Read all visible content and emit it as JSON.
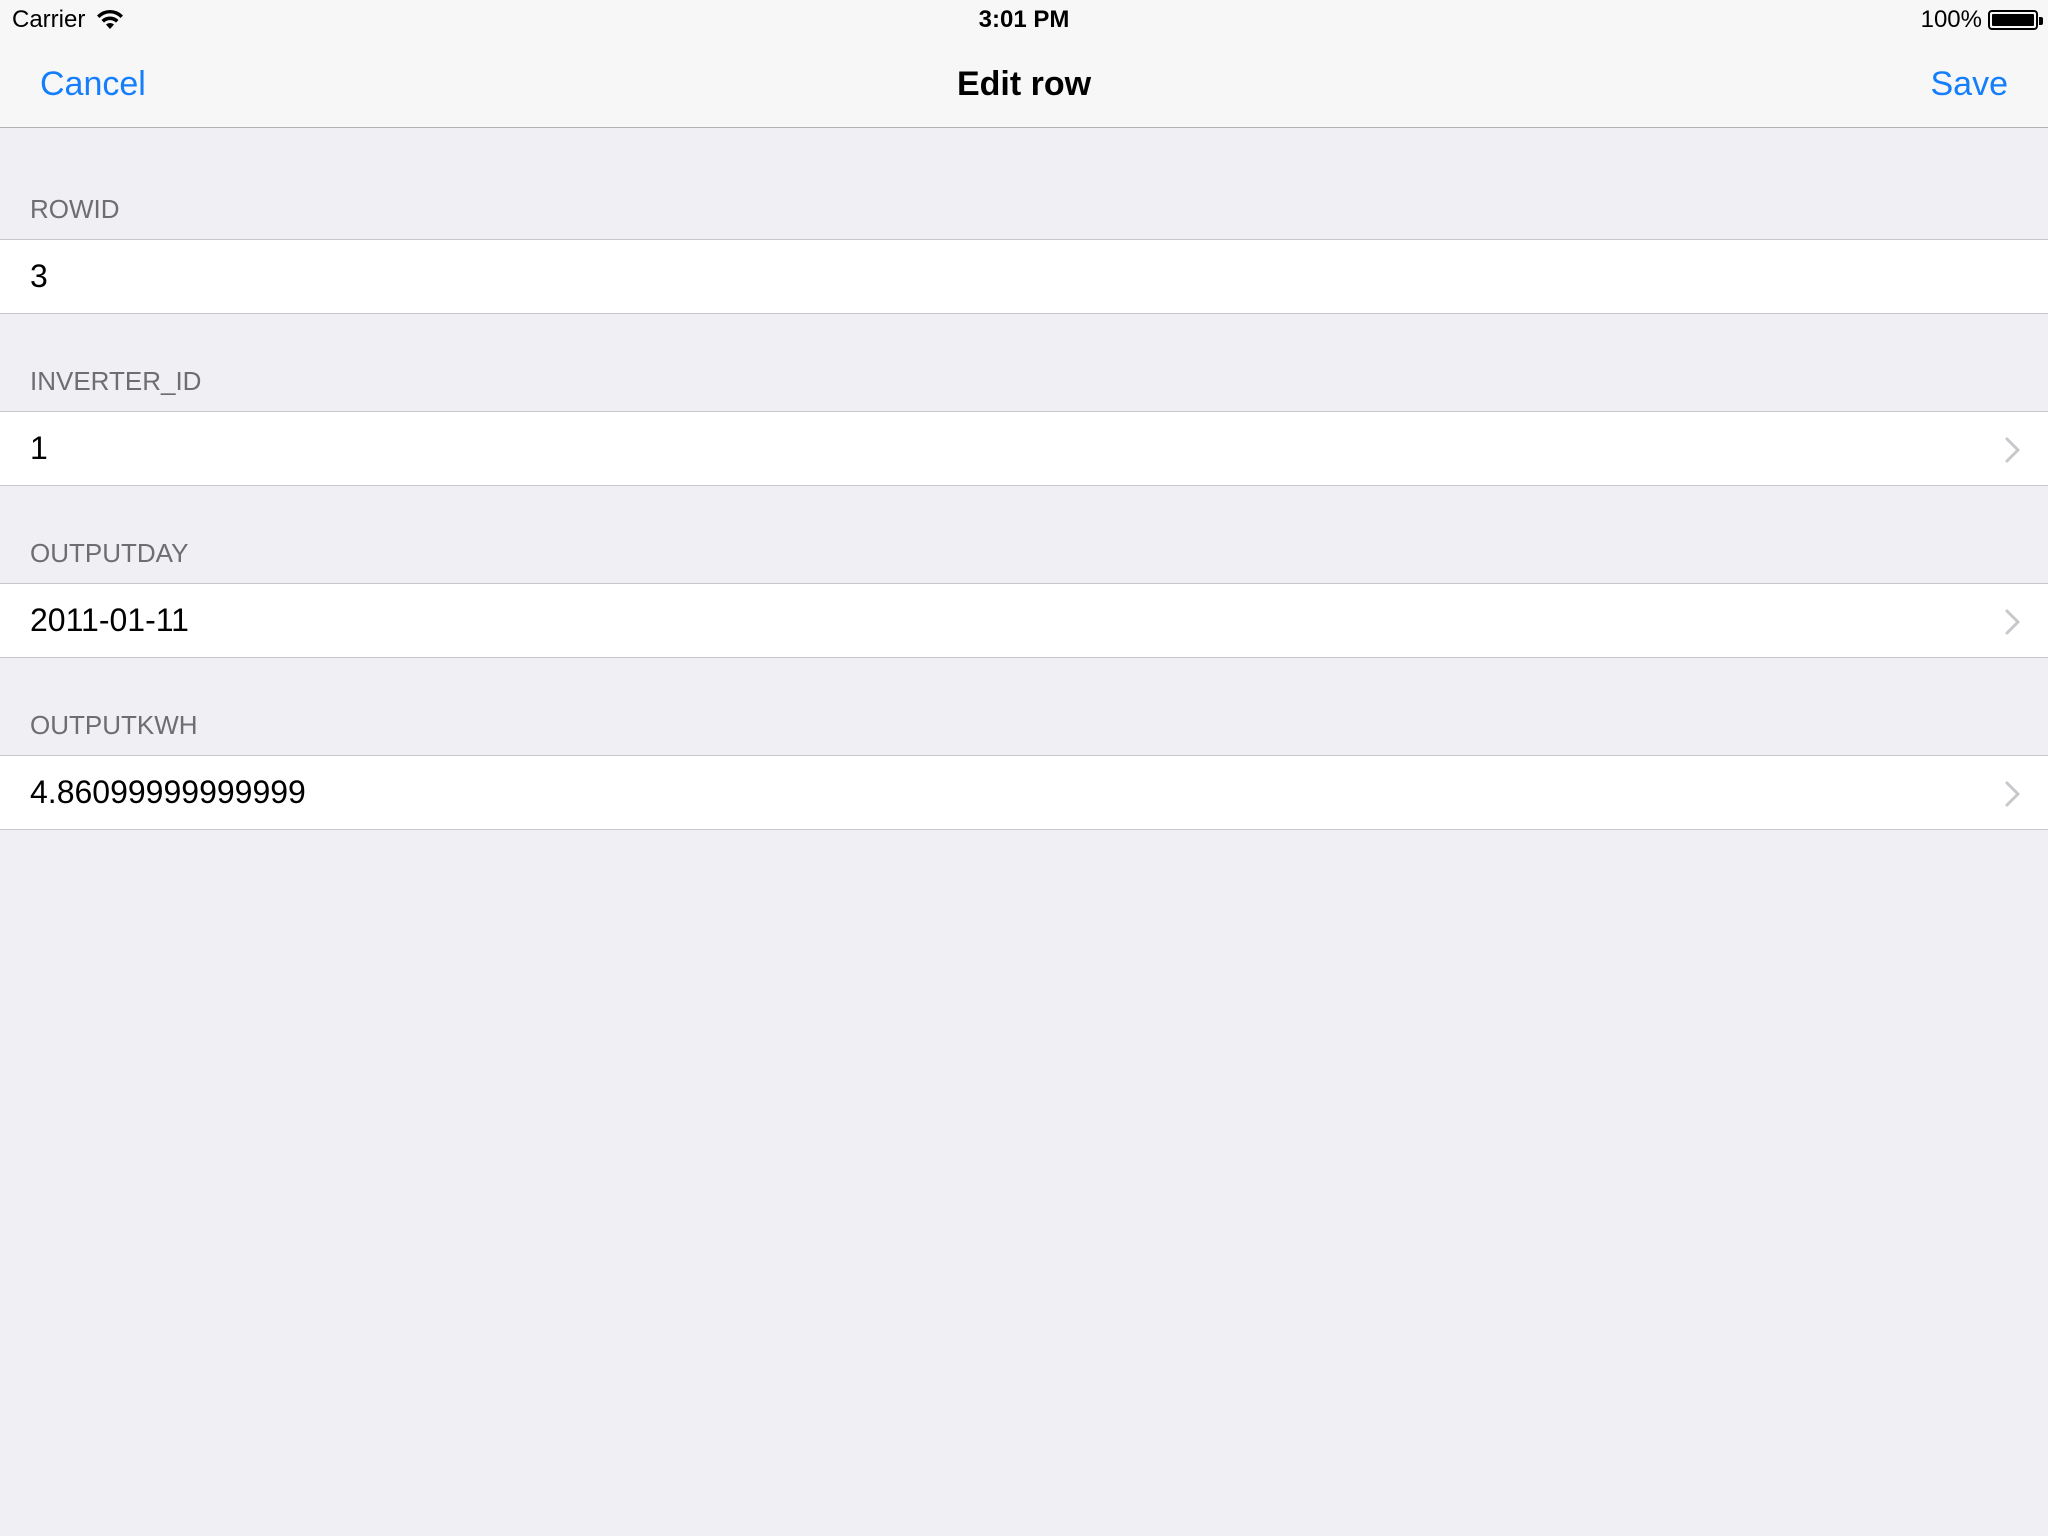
{
  "status_bar": {
    "carrier": "Carrier",
    "time": "3:01 PM",
    "battery": "100%",
    "battery_level": 1.0,
    "wifi_icon": "wifi-icon",
    "battery_icon": "battery-icon"
  },
  "nav": {
    "cancel_label": "Cancel",
    "title": "Edit row",
    "save_label": "Save",
    "accent_color": "#147efb"
  },
  "fields": [
    {
      "label": "ROWID",
      "value": "3",
      "has_chevron": false
    },
    {
      "label": "INVERTER_ID",
      "value": "1",
      "has_chevron": true
    },
    {
      "label": "OUTPUTDAY",
      "value": "2011-01-11",
      "has_chevron": true
    },
    {
      "label": "OUTPUTKWH",
      "value": "4.86099999999999",
      "has_chevron": true
    }
  ]
}
